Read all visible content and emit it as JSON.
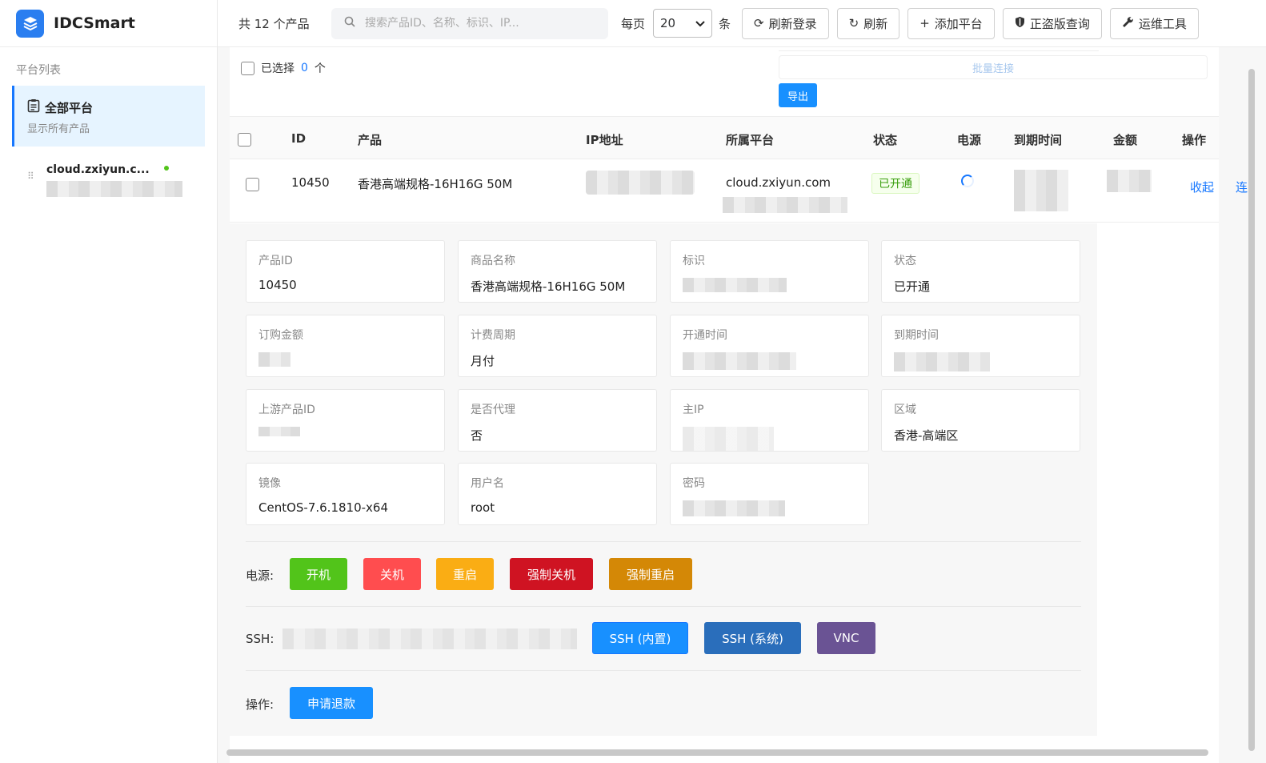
{
  "brand": {
    "name": "IDCSmart"
  },
  "sidebar": {
    "section_title": "平台列表",
    "active_item": {
      "title": "全部平台",
      "subtitle": "显示所有产品"
    },
    "platforms": [
      {
        "name": "cloud.zxiyun.c..."
      }
    ]
  },
  "topbar": {
    "total": "共 12 个产品",
    "search_placeholder": "搜索产品ID、名称、标识、IP...",
    "per_page_label": "每页",
    "per_page_value": "20",
    "per_page_unit": "条",
    "buttons": {
      "refresh_login": "刷新登录",
      "refresh": "刷新",
      "add_platform": "添加平台",
      "license_check": "正盗版查询",
      "ops_tools": "运维工具"
    }
  },
  "selection": {
    "label": "已选择",
    "count": "0",
    "unit": "个"
  },
  "batch": {
    "connect": "批量连接",
    "export": "导出"
  },
  "table": {
    "headers": {
      "id": "ID",
      "product": "产品",
      "ip": "IP地址",
      "platform": "所属平台",
      "status": "状态",
      "power": "电源",
      "expire": "到期时间",
      "amount": "金额",
      "actions": "操作"
    },
    "row": {
      "id": "10450",
      "product": "香港高端规格-16H16G 50M",
      "platform": "cloud.zxiyun.com",
      "status": "已开通",
      "collapse": "收起",
      "connect": "连"
    }
  },
  "detail": {
    "cards": {
      "product_id": {
        "label": "产品ID",
        "value": "10450"
      },
      "goods_name": {
        "label": "商品名称",
        "value": "香港高端规格-16H16G 50M"
      },
      "identifier": {
        "label": "标识"
      },
      "status": {
        "label": "状态",
        "value": "已开通"
      },
      "order_amount": {
        "label": "订购金额"
      },
      "billing_cycle": {
        "label": "计费周期",
        "value": "月付"
      },
      "open_time": {
        "label": "开通时间"
      },
      "expire_time": {
        "label": "到期时间"
      },
      "upstream_id": {
        "label": "上游产品ID"
      },
      "is_agent": {
        "label": "是否代理",
        "value": "否"
      },
      "main_ip": {
        "label": "主IP"
      },
      "region": {
        "label": "区域",
        "value": "香港-高端区"
      },
      "image": {
        "label": "镜像",
        "value": "CentOS-7.6.1810-x64"
      },
      "username": {
        "label": "用户名",
        "value": "root"
      },
      "password": {
        "label": "密码"
      }
    },
    "power": {
      "label": "电源:",
      "on": "开机",
      "off": "关机",
      "restart": "重启",
      "force_off": "强制关机",
      "force_restart": "强制重启"
    },
    "ssh": {
      "label": "SSH:",
      "internal": "SSH (内置)",
      "system": "SSH (系统)",
      "vnc": "VNC"
    },
    "ops": {
      "label": "操作:",
      "refund": "申请退款"
    }
  },
  "colors": {
    "accent": "#1677ff",
    "power_on": "#52c41a",
    "power_off": "#ff4d4f",
    "restart": "#faad14",
    "force_off": "#cf1322",
    "force_restart": "#d48806",
    "ssh_internal": "#1890ff",
    "ssh_system": "#2a6ebb",
    "vnc": "#6a5394"
  }
}
